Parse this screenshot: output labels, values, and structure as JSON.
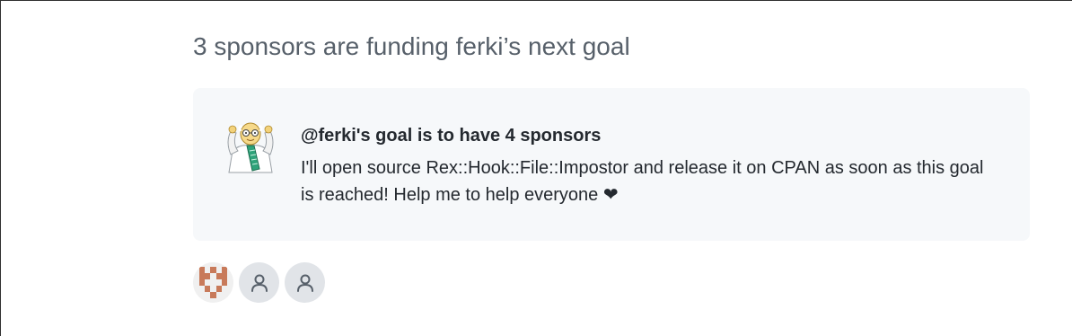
{
  "heading": "3 sponsors are funding ferki’s next goal",
  "goal": {
    "title": "@ferki's goal is to have 4 sponsors",
    "description": "I'll open source Rex::Hook::File::Impostor and release it on CPAN as soon as this goal is reached! Help me to help everyone ❤"
  },
  "sponsors": [
    {
      "avatar": "identicon-avatar",
      "color": "#c87a5a"
    },
    {
      "avatar": "person-icon"
    },
    {
      "avatar": "person-icon"
    }
  ],
  "colors": {
    "card_background": "#f6f8fa",
    "muted_text": "#57606a",
    "placeholder_avatar": "#e1e4e8"
  }
}
